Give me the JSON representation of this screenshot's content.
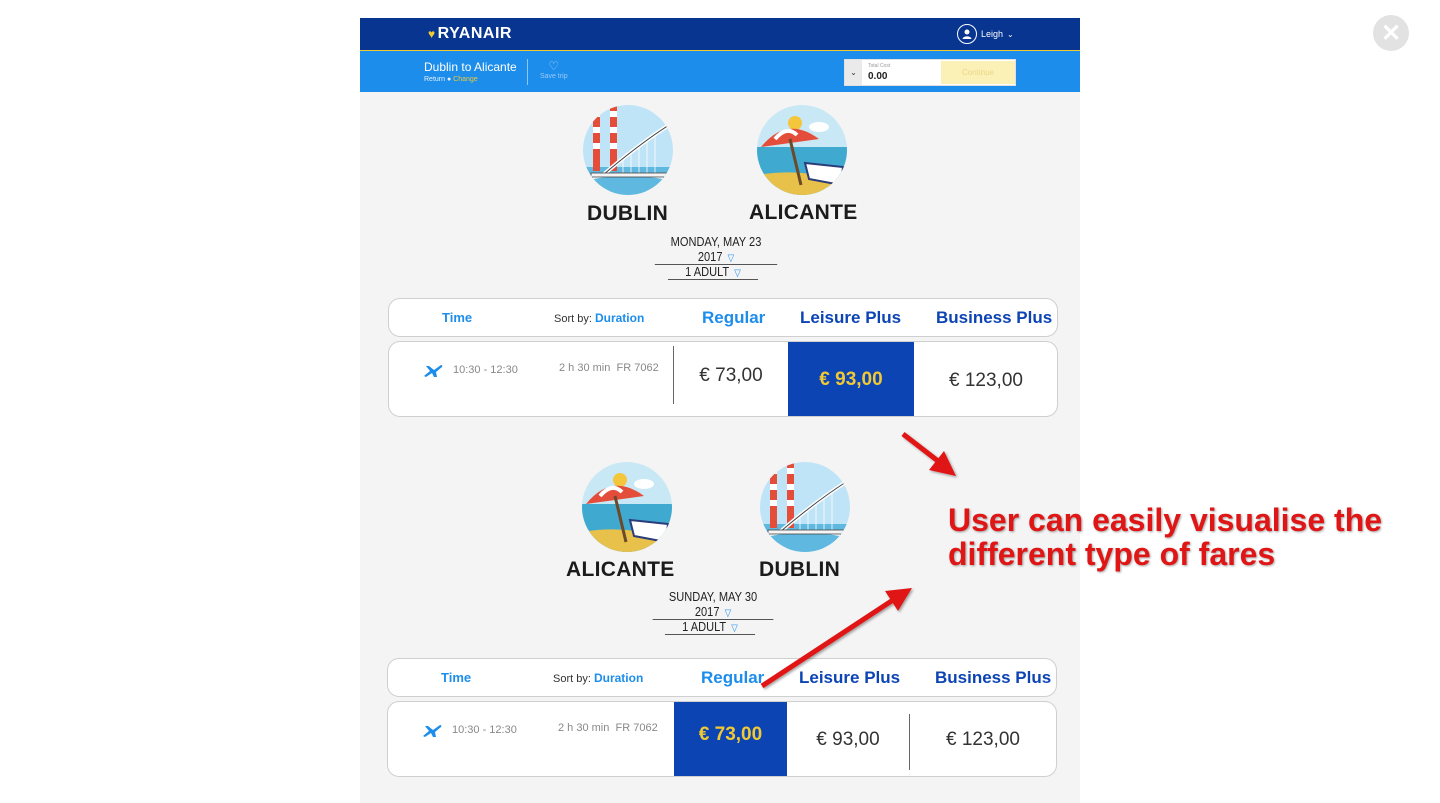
{
  "header": {
    "logo": "RYANAIR",
    "user_name": "Leigh"
  },
  "trip_bar": {
    "route": "Dublin to Alicante",
    "trip_type": "Return",
    "change_label": "Change",
    "save_trip_label": "Save trip",
    "total_cost_label": "Total Cost",
    "total_cost_value": "0.00",
    "continue_label": "Continue"
  },
  "outbound": {
    "origin": "DUBLIN",
    "destination": "ALICANTE",
    "date": "MONDAY, MAY 23 2017",
    "passengers": "1 ADULT",
    "table_header": {
      "time": "Time",
      "sort_by": "Sort by:",
      "sort_value": "Duration",
      "regular": "Regular",
      "leisure_plus": "Leisure Plus",
      "business_plus": "Business Plus"
    },
    "flight": {
      "times": "10:30  - 12:30",
      "duration": "2 h 30 min",
      "flight_number": "FR 7062",
      "regular": "€ 73,00",
      "leisure_plus": "€ 93,00",
      "business_plus": "€ 123,00",
      "selected_fare": "leisure_plus"
    }
  },
  "inbound": {
    "origin": "ALICANTE",
    "destination": "DUBLIN",
    "date": "SUNDAY, MAY 30 2017",
    "passengers": "1 ADULT",
    "table_header": {
      "time": "Time",
      "sort_by": "Sort by:",
      "sort_value": "Duration",
      "regular": "Regular",
      "leisure_plus": "Leisure Plus",
      "business_plus": "Business Plus"
    },
    "flight": {
      "times": "10:30  - 12:30",
      "duration": "2 h 30 min",
      "flight_number": "FR 7062",
      "regular": "€ 73,00",
      "leisure_plus": "€ 93,00",
      "business_plus": "€ 123,00",
      "selected_fare": "regular"
    }
  },
  "annotation": {
    "line1": "User can easily visualise the",
    "line2": "different type of fares"
  },
  "colors": {
    "brand_navy": "#073590",
    "brand_blue": "#1d8dec",
    "brand_yellow": "#f1c933",
    "selected_fare_bg": "#0c44b4",
    "annotation_red": "#e01515"
  },
  "icons": [
    "close-icon",
    "user-avatar-icon",
    "chevron-down-icon",
    "heart-icon",
    "plane-icon",
    "dropdown-triangle-icon",
    "arrow-icon"
  ]
}
